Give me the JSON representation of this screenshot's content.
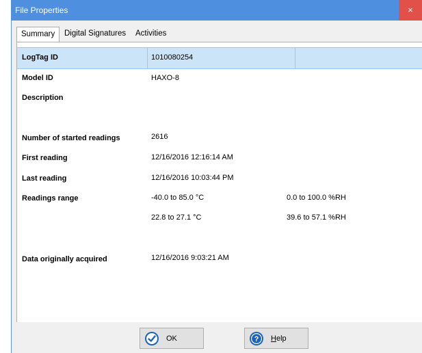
{
  "window": {
    "title": "File Properties",
    "close_glyph": "×"
  },
  "tabs": [
    {
      "label": "Summary",
      "active": true
    },
    {
      "label": "Digital Signatures",
      "active": false
    },
    {
      "label": "Activities",
      "active": false
    }
  ],
  "properties": {
    "logtag_id": {
      "label": "LogTag ID",
      "value": "1010080254"
    },
    "model_id": {
      "label": "Model ID",
      "value": "HAXO-8"
    },
    "description": {
      "label": "Description",
      "value": ""
    },
    "started_readings": {
      "label": "Number of started readings",
      "value": "2616"
    },
    "first_reading": {
      "label": "First reading",
      "value": "12/16/2016 12:16:14 AM"
    },
    "last_reading": {
      "label": "Last reading",
      "value": "12/16/2016 10:03:44 PM"
    },
    "readings_range": {
      "label": "Readings range",
      "temp_range": "-40.0  to  85.0  °C",
      "rh_range": "0.0  to  100.0  %RH"
    },
    "observed_range": {
      "temp_range": "22.8  to  27.1  °C",
      "rh_range": "39.6  to  57.1  %RH"
    },
    "data_acquired": {
      "label": "Data originally acquired",
      "value": "12/16/2016 9:03:21 AM"
    }
  },
  "buttons": {
    "ok_label": "OK",
    "help_label": "Help",
    "help_mnemonic": "H"
  },
  "colors": {
    "titlebar": "#4f8fe0",
    "close": "#e2504a",
    "selection": "#cce4f7",
    "icon_blue": "#1a63b8"
  },
  "icons": {
    "ok": "check-circle-icon",
    "help": "question-circle-icon"
  }
}
